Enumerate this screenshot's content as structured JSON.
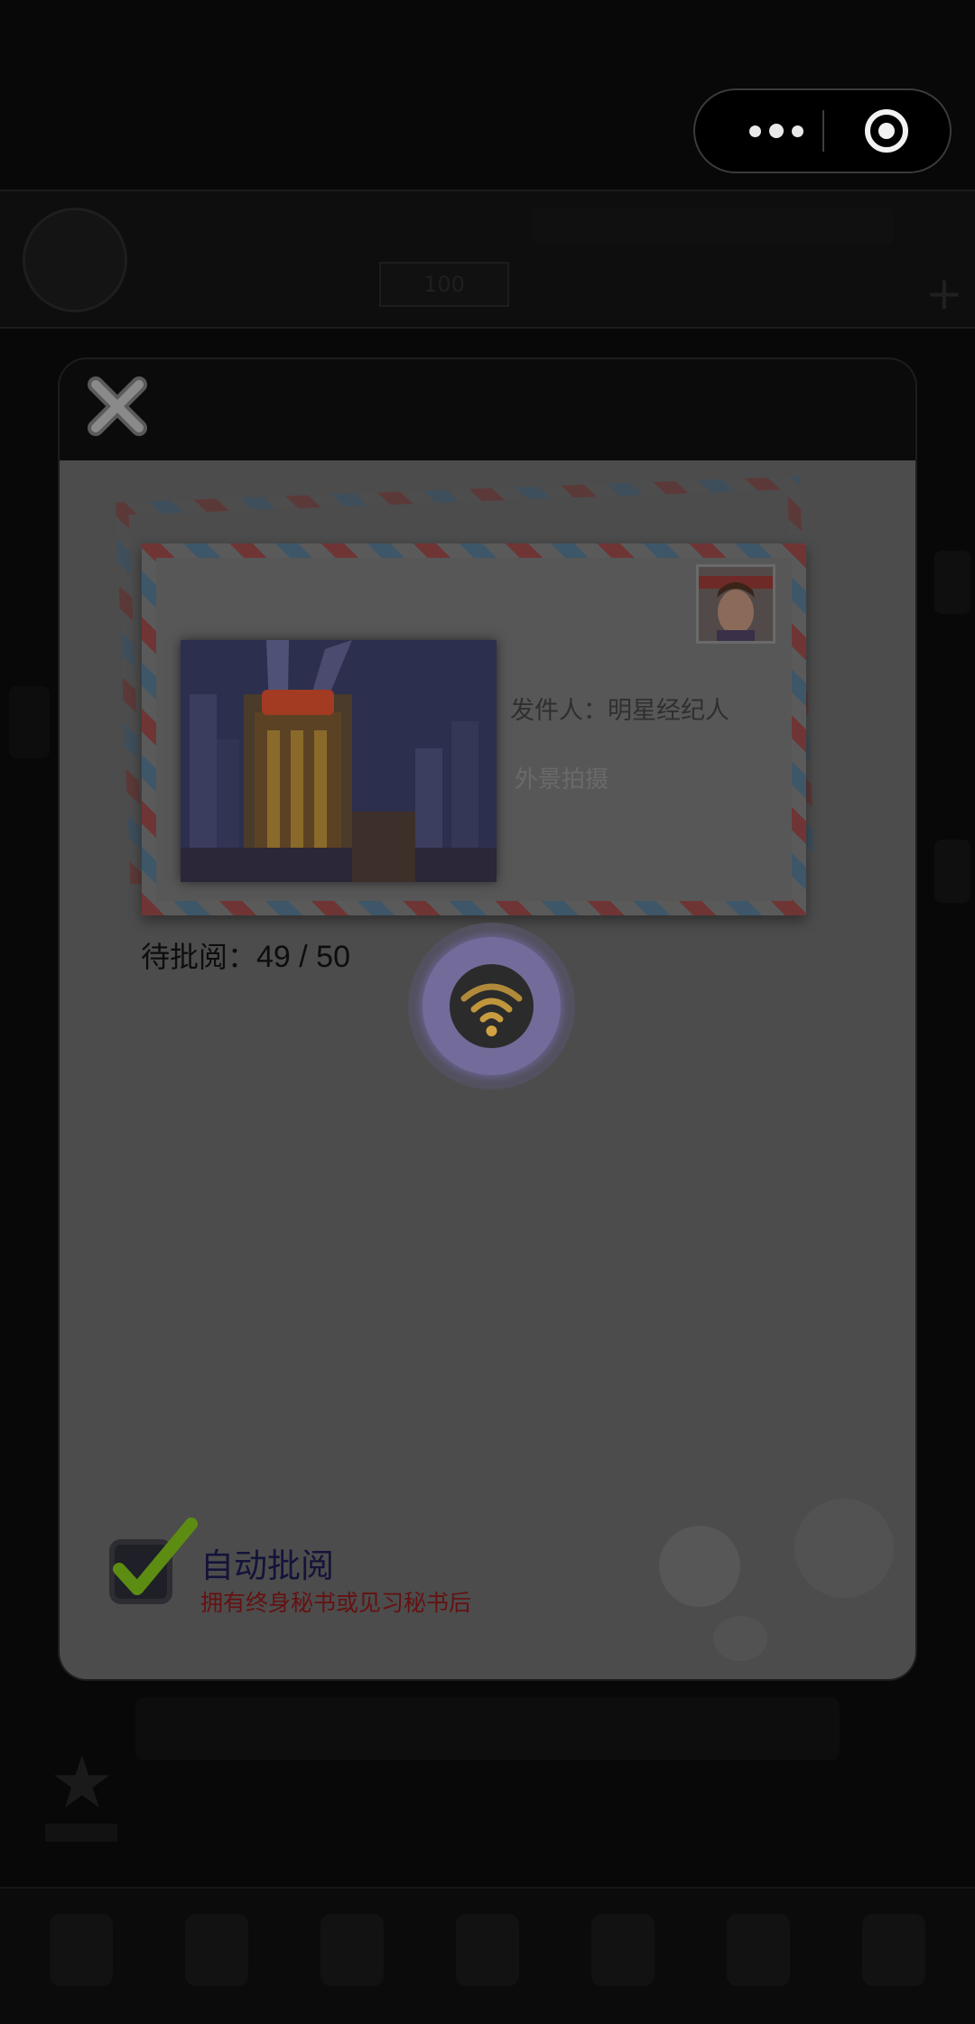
{
  "background": {
    "badge_text": "100"
  },
  "capsule": {
    "more_icon": "more-dots-icon",
    "close_icon": "target-close-icon"
  },
  "modal": {
    "close_icon": "close-x-icon",
    "letter": {
      "sender": "发件人：明星经纪人",
      "subject": "外景拍摄",
      "stamp_icon": "character-avatar-stamp",
      "photo_icon": "city-night-theater-photo"
    },
    "pending_label": "待批阅：",
    "pending_count": "49 / 50",
    "signal_icon": "wifi-signal-icon",
    "auto_review": {
      "label": "自动批阅",
      "hint": "拥有终身秘书或见习秘书后",
      "checked": true
    }
  },
  "colors": {
    "modal_body": "#4c4c4c",
    "signal_ring": "#736c9a",
    "signal_icon": "#d2a243",
    "check_green": "#5d8c12",
    "hint_red": "#651111"
  }
}
